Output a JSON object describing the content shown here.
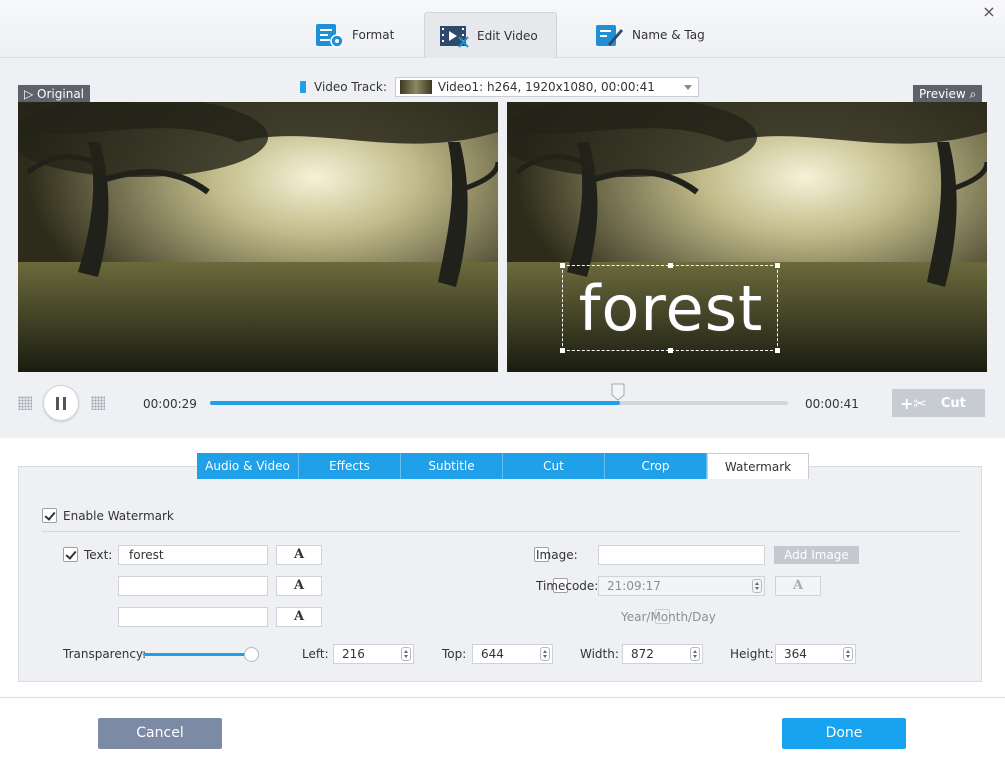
{
  "header": {
    "tabs": [
      {
        "label": "Format",
        "icon": "format-settings-icon"
      },
      {
        "label": "Edit Video",
        "icon": "edit-video-icon",
        "active": true
      },
      {
        "label": "Name & Tag",
        "icon": "name-tag-icon"
      }
    ],
    "close_icon": "×"
  },
  "preview": {
    "original_label": "Original",
    "preview_label": "Preview",
    "video_track_label": "Video Track:",
    "video_track_value": "Video1: h264, 1920x1080, 00:00:41",
    "watermark_text": "forest"
  },
  "player": {
    "current_time": "00:00:29",
    "total_time": "00:00:41",
    "progress": 0.71,
    "cut_label": "Cut"
  },
  "edit_tabs": [
    "Audio & Video",
    "Effects",
    "Subtitle",
    "Cut",
    "Crop",
    "Watermark"
  ],
  "watermark": {
    "enable_label": "Enable Watermark",
    "enabled": true,
    "text_label": "Text:",
    "text_checked": true,
    "text_values": [
      "forest",
      "",
      ""
    ],
    "font_glyph": "A",
    "image_label": "Image:",
    "image_value": "",
    "add_image_label": "Add Image",
    "timecode_label": "Timecode:",
    "timecode_value": "21:09:17",
    "year_label": "Year/Month/Day",
    "transparency_label": "Transparency:",
    "transparency": 1.0,
    "left_label": "Left:",
    "left_value": "216",
    "top_label": "Top:",
    "top_value": "644",
    "width_label": "Width:",
    "width_value": "872",
    "height_label": "Height:",
    "height_value": "364"
  },
  "footer": {
    "cancel_label": "Cancel",
    "done_label": "Done"
  },
  "colors": {
    "accent": "#1fa0e8",
    "cancel": "#7c8aa6",
    "done": "#17a3ee"
  }
}
